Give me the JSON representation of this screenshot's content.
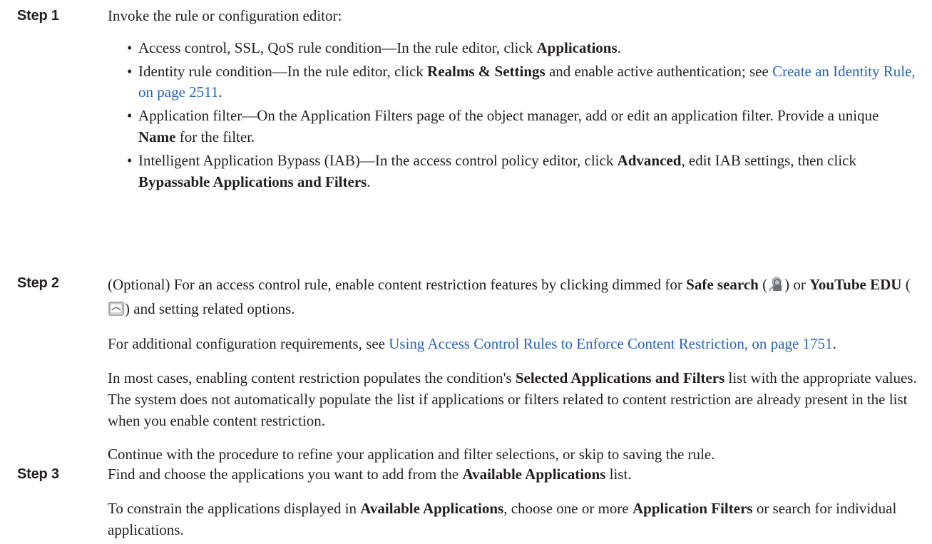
{
  "step1": {
    "label": "Step 1",
    "intro": "Invoke the rule or configuration editor:",
    "bullets": [
      {
        "a": "Access control, SSL, QoS rule condition—In the rule editor, click ",
        "b": "Applications",
        "c": "."
      },
      {
        "a": "Identity rule condition—In the rule editor, click ",
        "b": "Realms & Settings",
        "c": " and enable active authentication; see ",
        "link": "Create an Identity Rule, on page 2511",
        "d": "."
      },
      {
        "a": "Application filter—On the Application Filters page of the object manager, add or edit an application filter. Provide a unique ",
        "b": "Name",
        "c": " for the filter."
      },
      {
        "a": "Intelligent Application Bypass (IAB)—In the access control policy editor, click ",
        "b": "Advanced",
        "c": ", edit IAB settings, then click ",
        "d": "Bypassable Applications and Filters",
        "e": "."
      }
    ]
  },
  "step2": {
    "label": "Step 2",
    "p1_a": "(Optional) For an access control rule, enable content restriction features by clicking dimmed for ",
    "p1_safe": "Safe search",
    "p1_b": " (",
    "p1_c": ") or ",
    "p1_yt": "YouTube EDU",
    "p1_d": " (",
    "p1_e": ") and setting related options.",
    "p2_a": "For additional configuration requirements, see ",
    "p2_link": "Using Access Control Rules to Enforce Content Restriction, on page 1751",
    "p2_b": ".",
    "p3_a": "In most cases, enabling content restriction populates the condition's ",
    "p3_b": "Selected Applications and Filters",
    "p3_c": " list with the appropriate values. The system does not automatically populate the list if applications or filters related to content restriction are already present in the list when you enable content restriction.",
    "p4": "Continue with the procedure to refine your application and filter selections, or skip to saving the rule.",
    "icons": [
      "safe-search-icon",
      "youtube-edu-icon"
    ]
  },
  "step3": {
    "label": "Step 3",
    "p1_a": "Find and choose the applications you want to add from the ",
    "p1_b": "Available Applications",
    "p1_c": " list.",
    "p2_a": "To constrain the applications displayed in ",
    "p2_b": "Available Applications",
    "p2_c": ", choose one or more ",
    "p2_d": "Application Filters",
    "p2_e": " or search for individual applications."
  },
  "colors": {
    "text": "#231f20",
    "link": "#2563b8"
  }
}
